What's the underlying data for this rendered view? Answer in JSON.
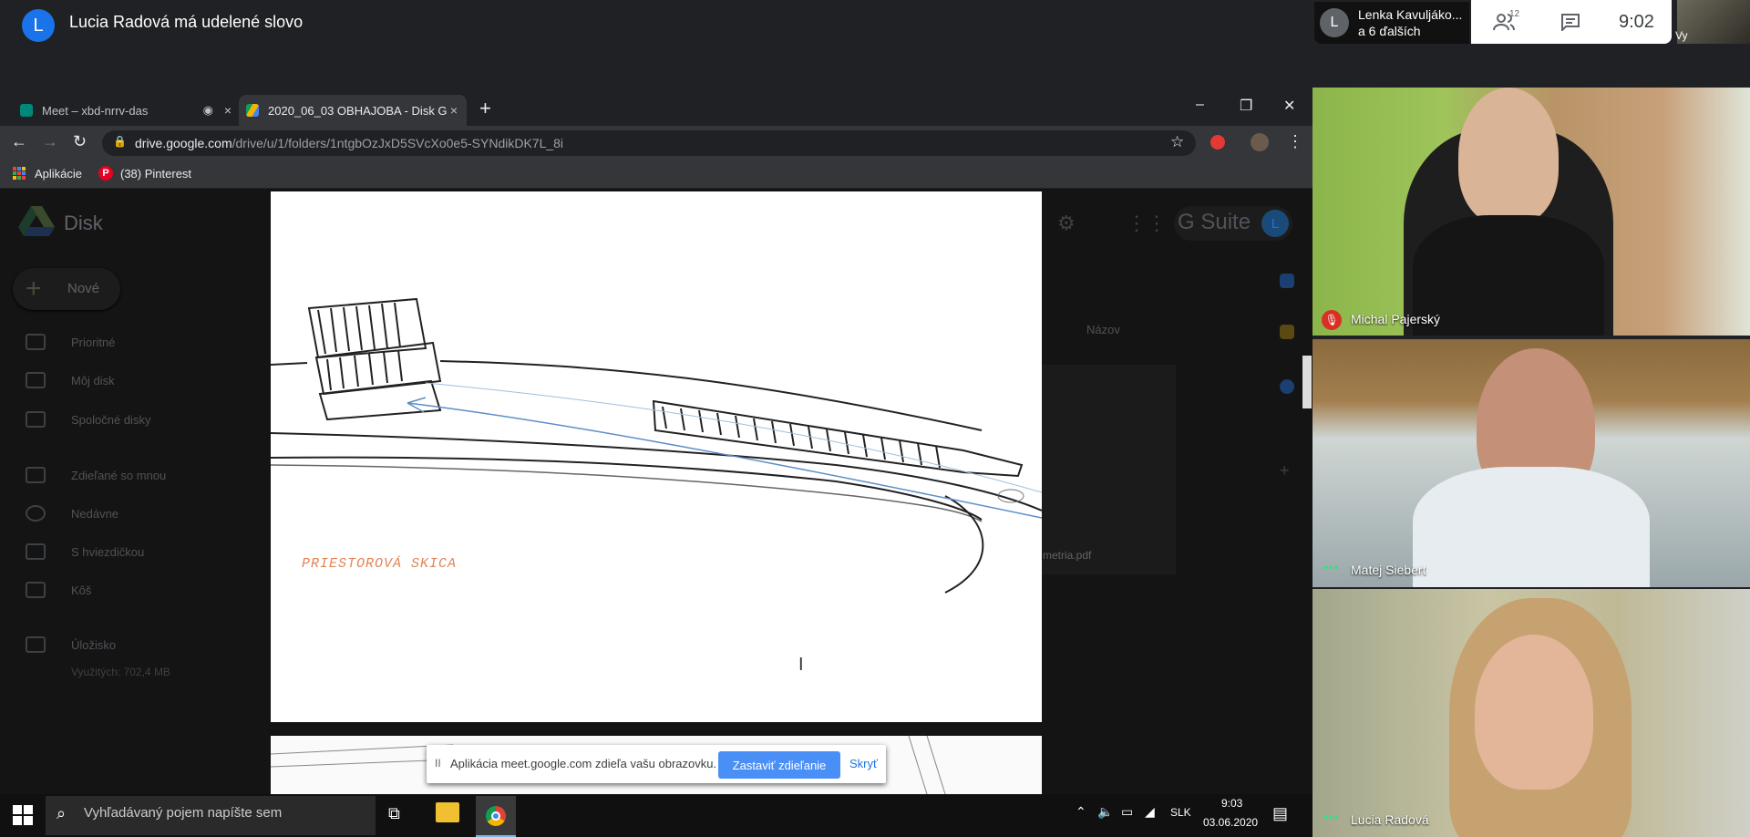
{
  "meet": {
    "speaker_avatar_letter": "L",
    "speaker_text": "Lucia Radová má udelené slovo",
    "chip_avatar_letter": "L",
    "chip_name": "Lenka Kavuljáko...",
    "chip_sub": "a 6 ďalších",
    "people_count": "12",
    "clock": "9:02",
    "self_label": "Vy"
  },
  "browser": {
    "tabs": [
      {
        "title": "Meet – xbd-nrrv-das",
        "favicon": "meet-icon",
        "close": "×"
      },
      {
        "title": "2020_06_03 OBHAJOBA - Disk G",
        "favicon": "drive-icon",
        "close": "×"
      }
    ],
    "new_tab": "+",
    "window_buttons": {
      "minimize": "–",
      "restore": "❐",
      "close": "✕"
    },
    "url_host": "drive.google.com",
    "url_path": "/drive/u/1/folders/1ntgbOzJxD5SVcXo0e5-SYNdikDK7L_8i",
    "bookmarks": [
      {
        "label": "Aplikácie",
        "icon": "apps-grid-icon"
      },
      {
        "label": "(38) Pinterest",
        "icon": "pinterest-icon"
      }
    ]
  },
  "drive": {
    "title": "Disk",
    "new_button": "Nové",
    "sidebar": [
      {
        "label": "Prioritné"
      },
      {
        "label": "Môj disk"
      },
      {
        "label": "Spoločné disky"
      },
      {
        "label": "Zdieľané so mnou"
      },
      {
        "label": "Nedávne"
      },
      {
        "label": "S hviezdičkou"
      },
      {
        "label": "Kôš"
      },
      {
        "label": "Úložisko"
      }
    ],
    "storage_used": "Využitých: 702,4 MB",
    "gsuite": "G Suite",
    "avatar_letter": "L",
    "sort_label": "Názov",
    "file_label": "metria.pdf"
  },
  "preview": {
    "label": "PRIESTOROVÁ SKICA"
  },
  "share_bar": {
    "pause": "II",
    "text": "Aplikácia meet.google.com zdieľa vašu obrazovku.",
    "stop": "Zastaviť zdieľanie",
    "hide": "Skryť"
  },
  "taskbar": {
    "search_placeholder": "Vyhľadávaný pojem napíšte sem",
    "language": "SLK",
    "time": "9:03",
    "date": "03.06.2020"
  },
  "participants": [
    {
      "name": "Michal Pajerský",
      "muted": true
    },
    {
      "name": "Matej Siebert",
      "muted": false
    },
    {
      "name": "Lucia Radová",
      "muted": false
    }
  ],
  "colors": {
    "meet_blue": "#1a73e8",
    "share_button": "#4a8ff6",
    "mute_red": "#d93025",
    "sketch_label": "#e28455"
  }
}
